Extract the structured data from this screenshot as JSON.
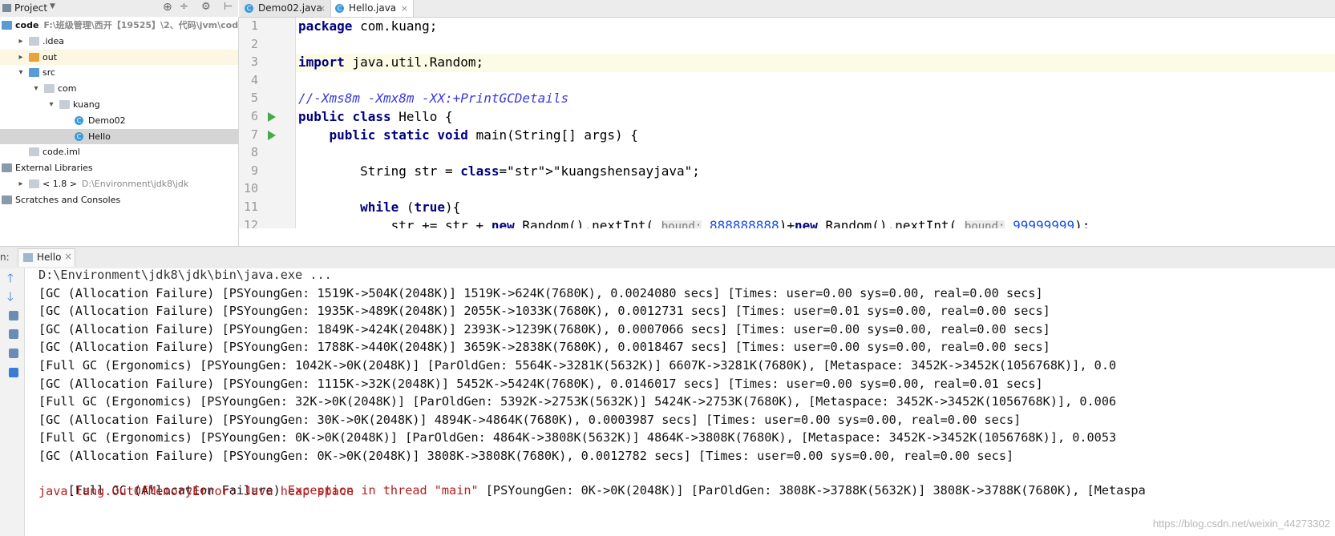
{
  "project_panel": {
    "title": "Project",
    "tree": [
      {
        "label": "code",
        "detail": "F:\\班级管理\\西开【19525】\\2、代码\\jvm\\code",
        "icon": "module-icon",
        "arrow": "",
        "indent": 0
      },
      {
        "label": ".idea",
        "detail": "",
        "icon": "folder-icon",
        "arrow": "chevron-right",
        "indent": 1
      },
      {
        "label": "out",
        "detail": "",
        "icon": "folder-orange-icon",
        "arrow": "chevron-right",
        "indent": 1
      },
      {
        "label": "src",
        "detail": "",
        "icon": "folder-blue-icon",
        "arrow": "chevron-down",
        "indent": 1
      },
      {
        "label": "com",
        "detail": "",
        "icon": "package-icon",
        "arrow": "chevron-down",
        "indent": 2
      },
      {
        "label": "kuang",
        "detail": "",
        "icon": "package-icon",
        "arrow": "chevron-down",
        "indent": 3
      },
      {
        "label": "Demo02",
        "detail": "",
        "icon": "java-class-icon",
        "arrow": "",
        "indent": 4
      },
      {
        "label": "Hello",
        "detail": "",
        "icon": "java-class-icon",
        "arrow": "",
        "indent": 4
      },
      {
        "label": "code.iml",
        "detail": "",
        "icon": "iml-file-icon",
        "arrow": "",
        "indent": 1
      },
      {
        "label": "External Libraries",
        "detail": "",
        "icon": "library-icon",
        "arrow": "",
        "indent": 0
      },
      {
        "label": "< 1.8 >",
        "detail": "D:\\Environment\\jdk8\\jdk",
        "icon": "jdk-icon",
        "arrow": "chevron-right",
        "indent": 1
      },
      {
        "label": "Scratches and Consoles",
        "detail": "",
        "icon": "scratch-icon",
        "arrow": "",
        "indent": 0
      }
    ]
  },
  "editor_tabs": [
    {
      "label": "Demo02.java",
      "active": false
    },
    {
      "label": "Hello.java",
      "active": true
    }
  ],
  "editor": {
    "line_numbers": [
      "1",
      "2",
      "3",
      "4",
      "5",
      "6",
      "7",
      "8",
      "9",
      "10",
      "11",
      "12"
    ],
    "lines": [
      {
        "text": "package com.kuang;"
      },
      {
        "text": ""
      },
      {
        "text": "import java.util.Random;"
      },
      {
        "text": ""
      },
      {
        "text": "//-Xms8m -Xmx8m -XX:+PrintGCDetails"
      },
      {
        "text": "public class Hello {"
      },
      {
        "text": "    public static void main(String[] args) {"
      },
      {
        "text": ""
      },
      {
        "text": "        String str = \"kuangshensayjava\";"
      },
      {
        "text": ""
      },
      {
        "text": "        while (true){"
      },
      {
        "text": "            str += str + new Random().nextInt( bound: 888888888)+new Random().nextInt( bound: 99999999);"
      }
    ]
  },
  "run_panel": {
    "prefix": "n:",
    "tab_label": "Hello",
    "console": [
      {
        "text": "D:\\Environment\\jdk8\\jdk\\bin\\java.exe ...",
        "kind": "cmd"
      },
      {
        "text": "[GC (Allocation Failure) [PSYoungGen: 1519K->504K(2048K)] 1519K->624K(7680K), 0.0024080 secs] [Times: user=0.00 sys=0.00, real=0.00 secs]",
        "kind": "out"
      },
      {
        "text": "[GC (Allocation Failure) [PSYoungGen: 1935K->489K(2048K)] 2055K->1033K(7680K), 0.0012731 secs] [Times: user=0.01 sys=0.00, real=0.00 secs]",
        "kind": "out"
      },
      {
        "text": "[GC (Allocation Failure) [PSYoungGen: 1849K->424K(2048K)] 2393K->1239K(7680K), 0.0007066 secs] [Times: user=0.00 sys=0.00, real=0.00 secs]",
        "kind": "out"
      },
      {
        "text": "[GC (Allocation Failure) [PSYoungGen: 1788K->440K(2048K)] 3659K->2838K(7680K), 0.0018467 secs] [Times: user=0.00 sys=0.00, real=0.00 secs]",
        "kind": "out"
      },
      {
        "text": "[Full GC (Ergonomics) [PSYoungGen: 1042K->0K(2048K)] [ParOldGen: 5564K->3281K(5632K)] 6607K->3281K(7680K), [Metaspace: 3452K->3452K(1056768K)], 0.0",
        "kind": "out"
      },
      {
        "text": "[GC (Allocation Failure) [PSYoungGen: 1115K->32K(2048K)] 5452K->5424K(7680K), 0.0146017 secs] [Times: user=0.00 sys=0.00, real=0.01 secs]",
        "kind": "out"
      },
      {
        "text": "[Full GC (Ergonomics) [PSYoungGen: 32K->0K(2048K)] [ParOldGen: 5392K->2753K(5632K)] 5424K->2753K(7680K), [Metaspace: 3452K->3452K(1056768K)], 0.006",
        "kind": "out"
      },
      {
        "text": "[GC (Allocation Failure) [PSYoungGen: 30K->0K(2048K)] 4894K->4864K(7680K), 0.0003987 secs] [Times: user=0.00 sys=0.00, real=0.00 secs]",
        "kind": "out"
      },
      {
        "text": "[Full GC (Ergonomics) [PSYoungGen: 0K->0K(2048K)] [ParOldGen: 4864K->3808K(5632K)] 4864K->3808K(7680K), [Metaspace: 3452K->3452K(1056768K)], 0.0053",
        "kind": "out"
      },
      {
        "text": "[GC (Allocation Failure) [PSYoungGen: 0K->0K(2048K)] 3808K->3808K(7680K), 0.0012782 secs] [Times: user=0.00 sys=0.00, real=0.00 secs]",
        "kind": "out"
      }
    ],
    "mixed_line": {
      "part1": "[Full GC (Allocation Failure) ",
      "part2": "Exception in thread \"main\" ",
      "part3": "[PSYoungGen: 0K->0K(2048K)] [ParOldGen: 3808K->3788K(5632K)] 3808K->3788K(7680K), [Metaspa"
    },
    "error_line": "java.lang.OutOfMemoryError: Java heap space"
  },
  "watermark": "https://blog.csdn.net/weixin_44273302"
}
